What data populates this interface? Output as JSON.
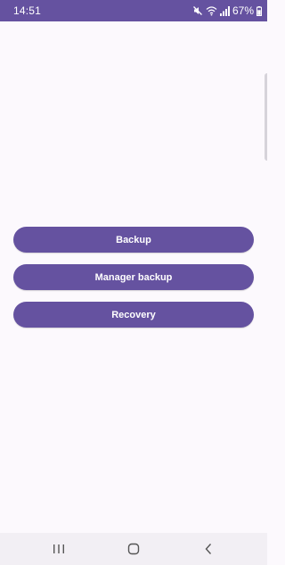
{
  "status_bar": {
    "time": "14:51",
    "battery_percent": "67%",
    "icons": [
      "mute-icon",
      "wifi-icon",
      "signal-icon",
      "battery-icon"
    ]
  },
  "buttons": {
    "backup": "Backup",
    "manager_backup": "Manager backup",
    "recovery": "Recovery"
  },
  "nav_bar": {
    "icons": [
      "recent-apps-icon",
      "home-icon",
      "back-icon"
    ]
  },
  "colors": {
    "primary": "#6552a0",
    "background": "#fcf9fd",
    "nav_background": "#f2eff4"
  }
}
